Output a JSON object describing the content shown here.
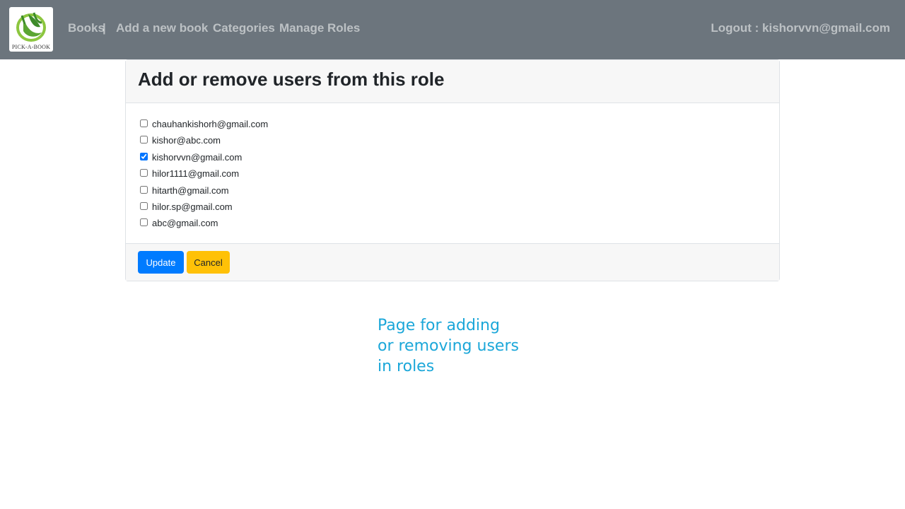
{
  "nav": {
    "logo_text": "PICK-A-BOOK",
    "links": [
      "Books",
      "Add a new book",
      "Categories",
      "Manage Roles"
    ],
    "separator": "|",
    "logout": "Logout : kishorvvn@gmail.com"
  },
  "card": {
    "title": "Add or remove users from this role",
    "users": [
      {
        "email": "chauhankishorh@gmail.com",
        "checked": false
      },
      {
        "email": "kishor@abc.com",
        "checked": false
      },
      {
        "email": "kishorvvn@gmail.com",
        "checked": true
      },
      {
        "email": "hilor1111@gmail.com",
        "checked": false
      },
      {
        "email": "hitarth@gmail.com",
        "checked": false
      },
      {
        "email": "hilor.sp@gmail.com",
        "checked": false
      },
      {
        "email": "abc@gmail.com",
        "checked": false
      }
    ],
    "update_label": "Update",
    "cancel_label": "Cancel"
  },
  "annotation": "Page for adding or removing users in roles",
  "colors": {
    "navbar": "#6c757d",
    "primary": "#007bff",
    "warning": "#ffc107",
    "annotation": "#1ba7d9",
    "logo_green": "#5aa532"
  }
}
